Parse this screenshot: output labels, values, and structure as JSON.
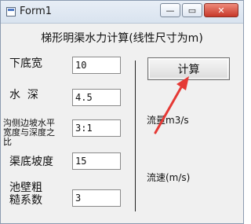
{
  "window": {
    "title": "Form1",
    "minimize_glyph": "—",
    "restore_glyph": "▭",
    "close_glyph": "✕"
  },
  "heading": "梯形明渠水力计算(线性尺寸为m)",
  "fields": [
    {
      "label": "下底宽",
      "value": "10"
    },
    {
      "label": "水  深",
      "value": "4.5"
    },
    {
      "label_line1": "沟侧边坡水平",
      "label_line2": "宽度与深度之",
      "label_line3": "比",
      "value": "3:1"
    },
    {
      "label": "渠底坡度",
      "value": "15"
    },
    {
      "label_line1": "池壁粗",
      "label_line2": "糙系数",
      "value": "3"
    }
  ],
  "button": {
    "label": "计算"
  },
  "results": {
    "flow_label": "流量m3/s",
    "velocity_label": "流速(m/s)"
  },
  "colors": {
    "annotation_arrow": "#e53935"
  }
}
